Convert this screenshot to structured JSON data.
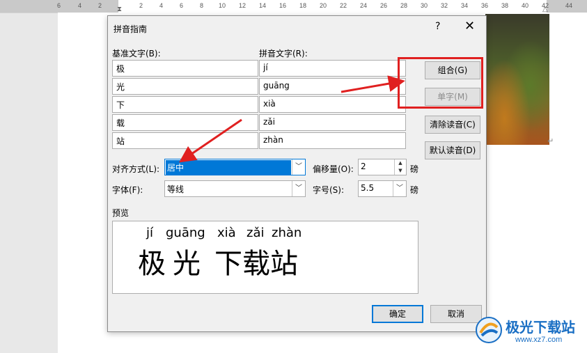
{
  "ruler": {
    "ticks": [
      "6",
      "4",
      "2",
      "2",
      "4",
      "6",
      "8",
      "10",
      "12",
      "14",
      "16",
      "18",
      "20",
      "22",
      "24",
      "26",
      "28",
      "30",
      "32",
      "34",
      "36",
      "38",
      "40",
      "42",
      "44"
    ]
  },
  "dialog": {
    "title": "拼音指南",
    "help": "?",
    "close": "✕",
    "base_label": "基准文字(B):",
    "pinyin_label": "拼音文字(R):",
    "rows": [
      {
        "base": "极",
        "pinyin": "jí"
      },
      {
        "base": "光",
        "pinyin": "guāng"
      },
      {
        "base": "下",
        "pinyin": "xià"
      },
      {
        "base": "载",
        "pinyin": "zǎi"
      },
      {
        "base": "站",
        "pinyin": "zhàn"
      }
    ],
    "buttons": {
      "combine": "组合(G)",
      "single": "单字(M)",
      "clear": "清除读音(C)",
      "default": "默认读音(D)",
      "ok": "确定",
      "cancel": "取消"
    },
    "align_label": "对齐方式(L):",
    "align_value": "居中",
    "offset_label": "偏移量(O):",
    "offset_value": "2",
    "offset_unit": "磅",
    "font_label": "字体(F):",
    "font_value": "等线",
    "size_label": "字号(S):",
    "size_value": "5.5",
    "size_unit": "磅",
    "preview_label": "预览",
    "preview_pinyin": [
      "jí",
      "guāng",
      "xià",
      "zǎi",
      "zhàn"
    ],
    "preview_base": [
      "极",
      "光",
      "下",
      "载",
      "站"
    ]
  },
  "watermark": {
    "name": "极光下载站",
    "url": "www.xz7.com"
  },
  "colors": {
    "highlight": "#0078d7",
    "annotation": "#e02020"
  }
}
